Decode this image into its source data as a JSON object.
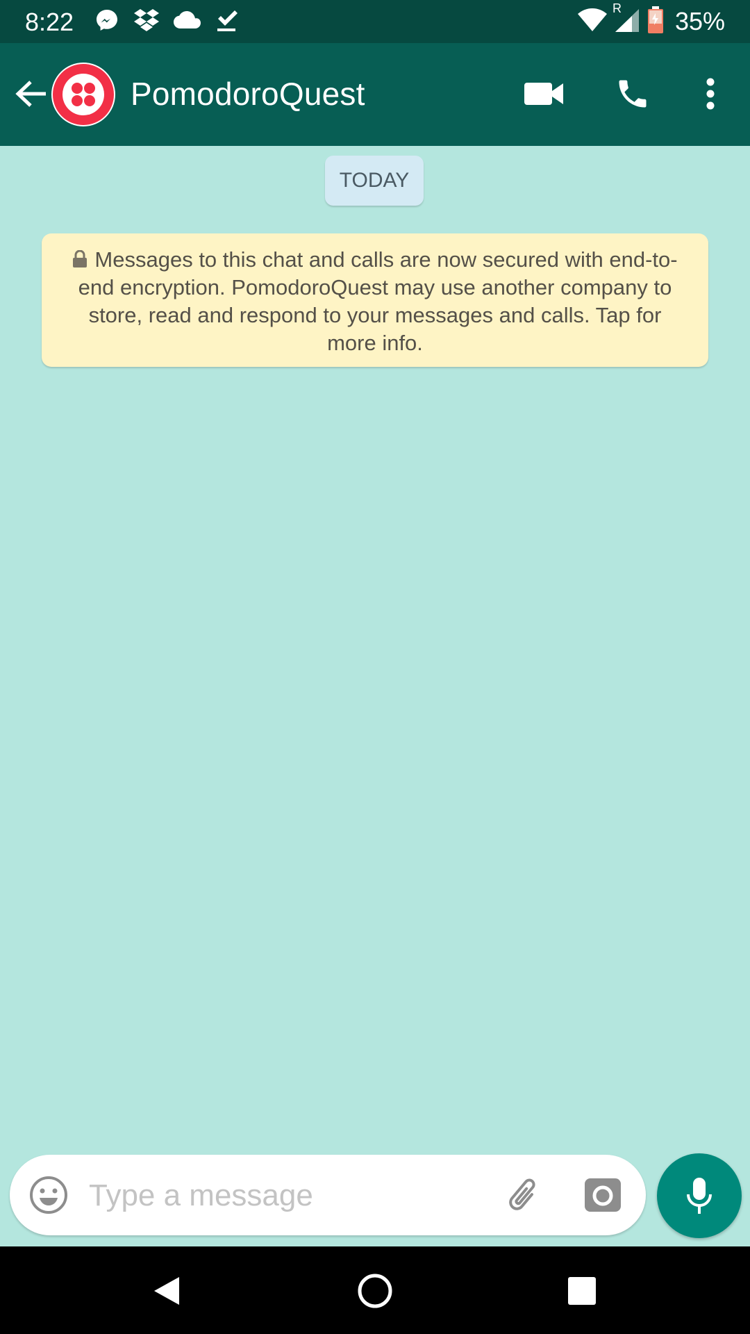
{
  "status_bar": {
    "time": "8:22",
    "battery_percent": "35%",
    "network_badge": "R",
    "notification_icons": [
      "messenger-icon",
      "dropbox-icon",
      "cloud-icon",
      "download-done-icon"
    ],
    "system_icons": [
      "wifi-icon",
      "cell-signal-icon",
      "battery-icon"
    ]
  },
  "app_bar": {
    "title": "PomodoroQuest",
    "actions": [
      "video-call-icon",
      "voice-call-icon",
      "more-options-icon"
    ],
    "colors": {
      "primary": "#075e54",
      "status": "#064940",
      "avatar": "#f22f46"
    }
  },
  "chat": {
    "date_label": "TODAY",
    "encryption_notice": "Messages to this chat and calls are now secured with end-to-end encryption. PomodoroQuest may use another company to store, read and respond to your messages and calls. Tap for more info.",
    "background_color": "#b4e6de"
  },
  "composer": {
    "placeholder": "Type a message",
    "value": "",
    "mic_color": "#00897b"
  },
  "nav_bar": {
    "buttons": [
      "back-icon",
      "home-icon",
      "recents-icon"
    ]
  }
}
